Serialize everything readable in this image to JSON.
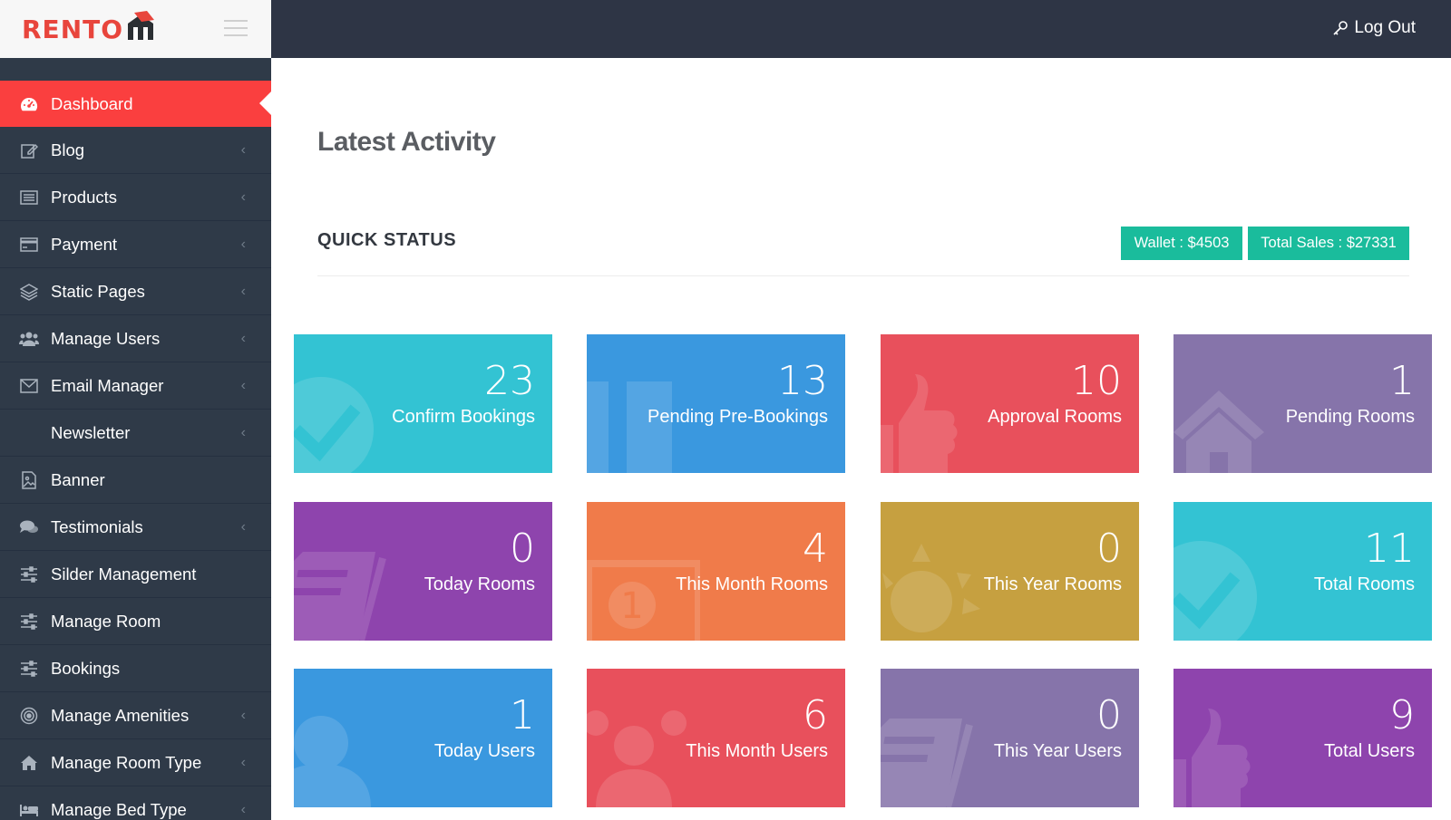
{
  "brand": {
    "name": "RENTOM",
    "text": "RENTO"
  },
  "header": {
    "logout_label": "Log Out"
  },
  "sidebar": {
    "items": [
      {
        "label": "Dashboard",
        "icon": "dashboard-icon",
        "active": true,
        "has_children": false
      },
      {
        "label": "Blog",
        "icon": "edit-icon",
        "has_children": true
      },
      {
        "label": "Products",
        "icon": "list-icon",
        "has_children": true
      },
      {
        "label": "Payment",
        "icon": "credit-card-icon",
        "has_children": true
      },
      {
        "label": "Static Pages",
        "icon": "layers-icon",
        "has_children": true
      },
      {
        "label": "Manage Users",
        "icon": "users-icon",
        "has_children": true
      },
      {
        "label": "Email Manager",
        "icon": "envelope-icon",
        "has_children": true
      },
      {
        "label": "Newsletter",
        "icon": "",
        "has_children": true
      },
      {
        "label": "Banner",
        "icon": "image-file-icon",
        "has_children": false
      },
      {
        "label": "Testimonials",
        "icon": "comments-icon",
        "has_children": true
      },
      {
        "label": "Silder Management",
        "icon": "sliders-icon",
        "has_children": false
      },
      {
        "label": "Manage Room",
        "icon": "sliders-icon",
        "has_children": false
      },
      {
        "label": "Bookings",
        "icon": "sliders-icon",
        "has_children": false
      },
      {
        "label": "Manage Amenities",
        "icon": "target-icon",
        "has_children": true
      },
      {
        "label": "Manage Room Type",
        "icon": "home-icon",
        "has_children": true
      },
      {
        "label": "Manage Bed Type",
        "icon": "bed-icon",
        "has_children": true
      }
    ]
  },
  "main": {
    "title": "Latest Activity",
    "section_title": "QUICK STATUS",
    "wallet_label": "Wallet : $4503",
    "sales_label": "Total Sales : $27331",
    "cards": [
      {
        "value": "23",
        "label": "Confirm Bookings",
        "color": "#33c3d3",
        "icon": "check-circle-icon"
      },
      {
        "value": "13",
        "label": "Pending Pre-Bookings",
        "color": "#3a98df",
        "icon": "columns-icon"
      },
      {
        "value": "10",
        "label": "Approval Rooms",
        "color": "#e8505c",
        "icon": "thumbs-up-icon"
      },
      {
        "value": "1",
        "label": "Pending Rooms",
        "color": "#8674aa",
        "icon": "home-icon"
      },
      {
        "value": "0",
        "label": "Today Rooms",
        "color": "#8e44ad",
        "icon": "document-icon"
      },
      {
        "value": "4",
        "label": "This Month Rooms",
        "color": "#f07b4a",
        "icon": "calendar-icon"
      },
      {
        "value": "0",
        "label": "This Year Rooms",
        "color": "#c6a040",
        "icon": "sun-icon"
      },
      {
        "value": "11",
        "label": "Total Rooms",
        "color": "#33c3d3",
        "icon": "check-circle-icon"
      },
      {
        "value": "1",
        "label": "Today Users",
        "color": "#3a98df",
        "icon": "user-icon"
      },
      {
        "value": "6",
        "label": "This Month Users",
        "color": "#e8505c",
        "icon": "users-icon"
      },
      {
        "value": "0",
        "label": "This Year Users",
        "color": "#8674aa",
        "icon": "document-icon"
      },
      {
        "value": "9",
        "label": "Total Users",
        "color": "#8e44ad",
        "icon": "thumbs-up-icon"
      }
    ]
  }
}
